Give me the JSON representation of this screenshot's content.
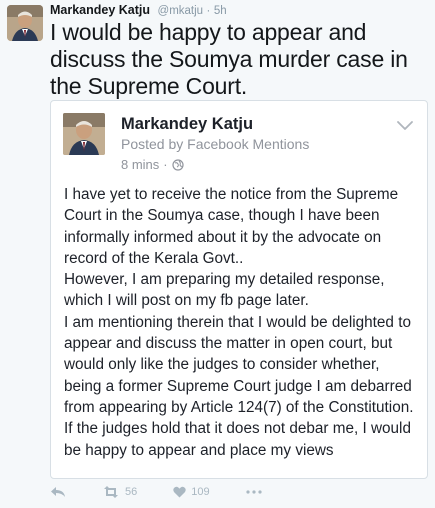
{
  "tweet": {
    "author_name": "Markandey Katju",
    "handle": "@mkatju",
    "separator": "·",
    "time": "5h",
    "text": "I would be happy to appear and discuss the Soumya murder case in the Supreme Court."
  },
  "embed": {
    "author_name": "Markandey Katju",
    "subtitle": "Posted by Facebook Mentions",
    "time": "8 mins",
    "separator": "·",
    "body": "I have yet to receive the notice from the Supreme Court in the Soumya case, though I have been informally informed about it by the advocate on record of the Kerala Govt..\n However, I am preparing my detailed response, which I will post on my fb page later.\n I am mentioning therein that I would be delighted to appear and discuss the matter in open court, but would only like the judges to consider whether, being a former Supreme Court judge I am debarred from appearing by Article 124(7) of the Constitution. If the judges hold that it does not debar me, I would be happy to appear and place my views"
  },
  "actions": {
    "retweet_count": "56",
    "like_count": "109"
  },
  "icons": {
    "avatar": "person-photo",
    "reply": "reply-icon",
    "retweet": "retweet-icon",
    "like": "heart-icon",
    "more": "more-dots-icon",
    "chevron": "chevron-down-icon",
    "globe": "globe-icon"
  }
}
